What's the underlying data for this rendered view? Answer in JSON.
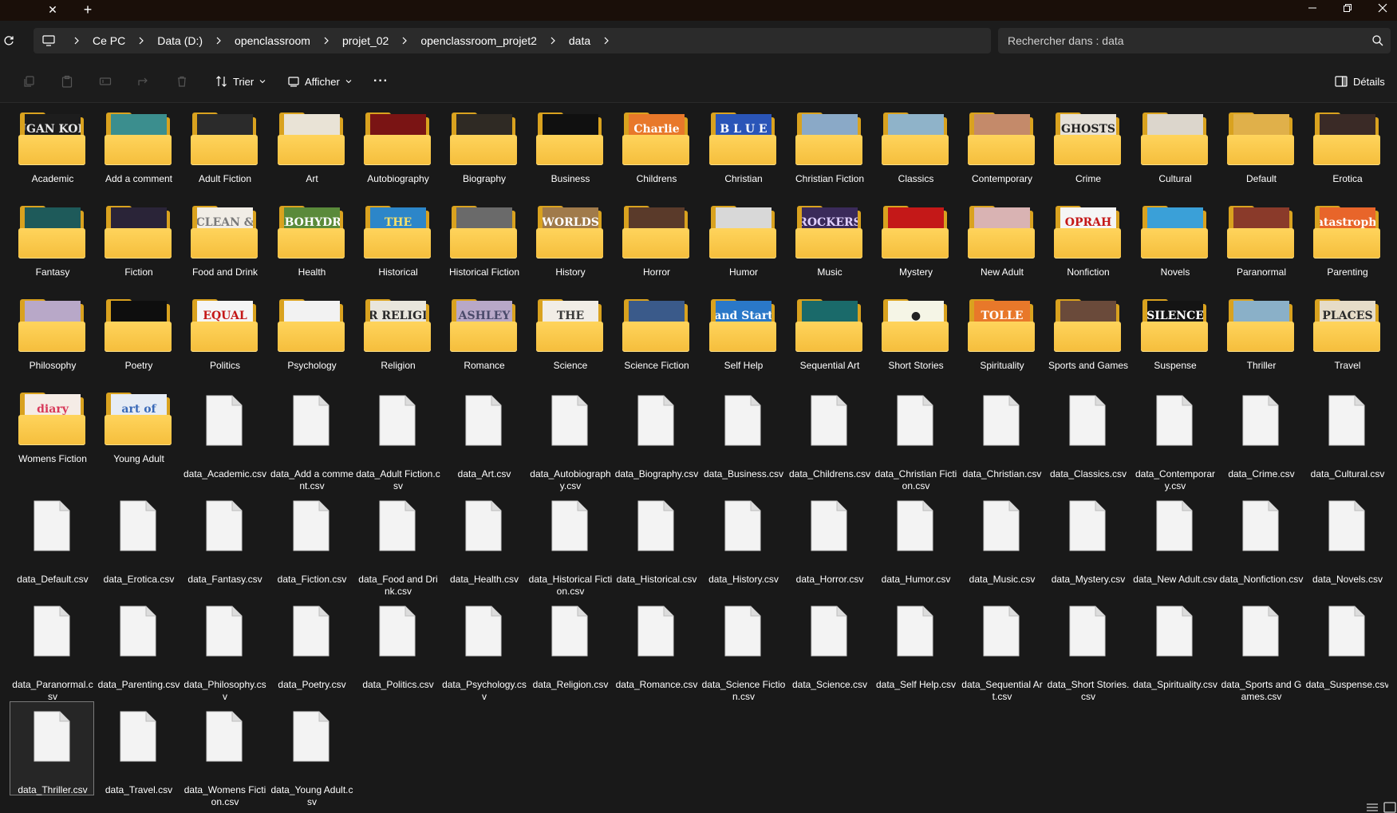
{
  "titlebar": {
    "tab_close_label": "✕",
    "tab_new_label": "+"
  },
  "address": {
    "breadcrumb": [
      "Ce PC",
      "Data (D:)",
      "openclassroom",
      "projet_02",
      "openclassroom_projet2",
      "data"
    ],
    "search_placeholder": "Rechercher dans : data"
  },
  "commandbar": {
    "sort_label": "Trier",
    "view_label": "Afficher",
    "more_label": "···",
    "details_label": "Détails"
  },
  "folders": [
    {
      "name": "Academic",
      "cover": "LUGAN KODE",
      "bg": "#1d1d1d",
      "fg": "#e8e8e8"
    },
    {
      "name": "Add a comment",
      "cover": "",
      "bg": "#3b8e8e",
      "fg": "#ffffff"
    },
    {
      "name": "Adult Fiction",
      "cover": "",
      "bg": "#2b2b2b",
      "fg": "#ffffff"
    },
    {
      "name": "Art",
      "cover": "",
      "bg": "#e9e3d6",
      "fg": "#6a5a4a"
    },
    {
      "name": "Autobiography",
      "cover": "",
      "bg": "#7a1414",
      "fg": "#ffffff"
    },
    {
      "name": "Biography",
      "cover": "",
      "bg": "#2f2a24",
      "fg": "#ffffff"
    },
    {
      "name": "Business",
      "cover": "",
      "bg": "#101010",
      "fg": "#ffffff"
    },
    {
      "name": "Childrens",
      "cover": "Charlie",
      "bg": "#e8782a",
      "fg": "#ffffff"
    },
    {
      "name": "Christian",
      "cover": "B L U E",
      "bg": "#2a55b8",
      "fg": "#ffffff"
    },
    {
      "name": "Christian Fiction",
      "cover": "",
      "bg": "#8aa9c7",
      "fg": "#ffffff"
    },
    {
      "name": "Classics",
      "cover": "",
      "bg": "#8fb3c9",
      "fg": "#ffffff"
    },
    {
      "name": "Contemporary",
      "cover": "",
      "bg": "#c48a6a",
      "fg": "#ffffff"
    },
    {
      "name": "Crime",
      "cover": "GHOSTS",
      "bg": "#e6e1d8",
      "fg": "#222222"
    },
    {
      "name": "Cultural",
      "cover": "",
      "bg": "#dcd6cc",
      "fg": "#222222"
    },
    {
      "name": "Default",
      "cover": "",
      "bg": "#e0b04a",
      "fg": "#ffffff"
    },
    {
      "name": "Erotica",
      "cover": "",
      "bg": "#3a2a26",
      "fg": "#ffffff"
    },
    {
      "name": "Fantasy",
      "cover": "",
      "bg": "#1e5a5a",
      "fg": "#ffffff"
    },
    {
      "name": "Fiction",
      "cover": "",
      "bg": "#2a2438",
      "fg": "#ffffff"
    },
    {
      "name": "Food and Drink",
      "cover": "CLEAN &",
      "bg": "#f1ede6",
      "fg": "#7a7a7a"
    },
    {
      "name": "Health",
      "cover": "CARBOHYDRATE",
      "bg": "#5a8a3a",
      "fg": "#ffffff"
    },
    {
      "name": "Historical",
      "cover": "THE",
      "bg": "#2c86c9",
      "fg": "#f5e06a"
    },
    {
      "name": "Historical Fiction",
      "cover": "",
      "bg": "#6a6a6a",
      "fg": "#ffffff"
    },
    {
      "name": "History",
      "cover": "WORLDS",
      "bg": "#a07a4a",
      "fg": "#ffffff"
    },
    {
      "name": "Horror",
      "cover": "",
      "bg": "#5a3a2a",
      "fg": "#ffffff"
    },
    {
      "name": "Humor",
      "cover": "",
      "bg": "#d8d8d8",
      "fg": "#444444"
    },
    {
      "name": "Music",
      "cover": "ROCKERS",
      "bg": "#3a2a5a",
      "fg": "#e0d0ff"
    },
    {
      "name": "Mystery",
      "cover": "",
      "bg": "#c41818",
      "fg": "#ffffff"
    },
    {
      "name": "New Adult",
      "cover": "",
      "bg": "#d9b3b3",
      "fg": "#ffffff"
    },
    {
      "name": "Nonfiction",
      "cover": "OPRAH",
      "bg": "#f5f5f5",
      "fg": "#c41818"
    },
    {
      "name": "Novels",
      "cover": "",
      "bg": "#3aa0d8",
      "fg": "#ffffff"
    },
    {
      "name": "Paranormal",
      "cover": "",
      "bg": "#8a3a2a",
      "fg": "#ffffff"
    },
    {
      "name": "Parenting",
      "cover": "Catastrophic",
      "bg": "#e8652a",
      "fg": "#ffffff"
    },
    {
      "name": "Philosophy",
      "cover": "",
      "bg": "#b8a8c8",
      "fg": "#ffffff"
    },
    {
      "name": "Poetry",
      "cover": "",
      "bg": "#0e0e0e",
      "fg": "#ffffff"
    },
    {
      "name": "Politics",
      "cover": "EQUAL",
      "bg": "#f5f5f5",
      "fg": "#c41818"
    },
    {
      "name": "Psychology",
      "cover": "",
      "bg": "#f2f2f2",
      "fg": "#d83a8a"
    },
    {
      "name": "Religion",
      "cover": "OUR RELIGION",
      "bg": "#e9e6dc",
      "fg": "#2a2a2a"
    },
    {
      "name": "Romance",
      "cover": "ASHLEY",
      "bg": "#b8a8c8",
      "fg": "#4a4a6a"
    },
    {
      "name": "Science",
      "cover": "THE",
      "bg": "#f1ede6",
      "fg": "#3a3a3a"
    },
    {
      "name": "Science Fiction",
      "cover": "",
      "bg": "#3a5a8a",
      "fg": "#ffffff"
    },
    {
      "name": "Self Help",
      "cover": "and Start",
      "bg": "#2a78c8",
      "fg": "#ffffff"
    },
    {
      "name": "Sequential Art",
      "cover": "",
      "bg": "#1a6a6a",
      "fg": "#ffffff"
    },
    {
      "name": "Short Stories",
      "cover": "●",
      "bg": "#f5f5e6",
      "fg": "#222222"
    },
    {
      "name": "Spirituality",
      "cover": "TOLLE",
      "bg": "#e8782a",
      "fg": "#ffffff"
    },
    {
      "name": "Sports and Games",
      "cover": "",
      "bg": "#6a4a3a",
      "fg": "#ffffff"
    },
    {
      "name": "Suspense",
      "cover": "SILENCE",
      "bg": "#141414",
      "fg": "#ffffff"
    },
    {
      "name": "Thriller",
      "cover": "",
      "bg": "#8ab0c8",
      "fg": "#222222"
    },
    {
      "name": "Travel",
      "cover": "PLACES",
      "bg": "#e6dcc8",
      "fg": "#2a2a2a"
    },
    {
      "name": "Womens Fiction",
      "cover": "diary",
      "bg": "#f5ece6",
      "fg": "#d83a5a"
    },
    {
      "name": "Young Adult",
      "cover": "art of",
      "bg": "#e6ecf5",
      "fg": "#3a6ab8"
    }
  ],
  "files": [
    "data_Academic.csv",
    "data_Add a comment.csv",
    "data_Adult Fiction.csv",
    "data_Art.csv",
    "data_Autobiography.csv",
    "data_Biography.csv",
    "data_Business.csv",
    "data_Childrens.csv",
    "data_Christian Fiction.csv",
    "data_Christian.csv",
    "data_Classics.csv",
    "data_Contemporary.csv",
    "data_Crime.csv",
    "data_Cultural.csv",
    "data_Default.csv",
    "data_Erotica.csv",
    "data_Fantasy.csv",
    "data_Fiction.csv",
    "data_Food and Drink.csv",
    "data_Health.csv",
    "data_Historical Fiction.csv",
    "data_Historical.csv",
    "data_History.csv",
    "data_Horror.csv",
    "data_Humor.csv",
    "data_Music.csv",
    "data_Mystery.csv",
    "data_New Adult.csv",
    "data_Nonfiction.csv",
    "data_Novels.csv",
    "data_Paranormal.csv",
    "data_Parenting.csv",
    "data_Philosophy.csv",
    "data_Poetry.csv",
    "data_Politics.csv",
    "data_Psychology.csv",
    "data_Religion.csv",
    "data_Romance.csv",
    "data_Science Fiction.csv",
    "data_Science.csv",
    "data_Self Help.csv",
    "data_Sequential Art.csv",
    "data_Short Stories.csv",
    "data_Spirituality.csv",
    "data_Sports and Games.csv",
    "data_Suspense.csv",
    "data_Thriller.csv",
    "data_Travel.csv",
    "data_Womens Fiction.csv",
    "data_Young Adult.csv"
  ],
  "selected_item": "data_Thriller.csv",
  "colors": {
    "folder_front": "#f5be3c",
    "folder_back": "#d9a21f",
    "background": "#191919",
    "selection_border": "#7a7a7a"
  }
}
